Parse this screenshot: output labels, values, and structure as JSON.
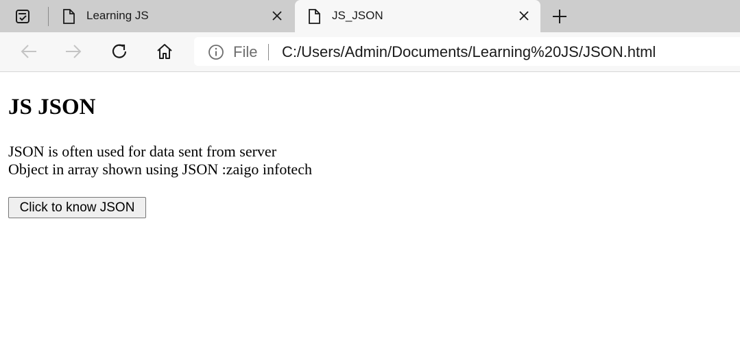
{
  "browser": {
    "tabs": [
      {
        "title": "Learning JS",
        "active": false
      },
      {
        "title": "JS_JSON",
        "active": true
      }
    ],
    "address_bar": {
      "scheme_label": "File",
      "url": "C:/Users/Admin/Documents/Learning%20JS/JSON.html"
    },
    "icons": {
      "tab_actions": "tab-actions-icon",
      "new_tab": "plus-icon",
      "back": "back-arrow-icon",
      "forward": "forward-arrow-icon",
      "reload": "reload-icon",
      "home": "home-icon",
      "site_info": "info-icon",
      "tab_favicon": "document-icon",
      "tab_close": "close-icon"
    },
    "colors": {
      "tabstrip": "#cdcdcd",
      "toolbar": "#f7f7f7",
      "page": "#ffffff"
    }
  },
  "page": {
    "heading": "JS JSON",
    "lines": [
      "JSON is often used for data sent from server",
      "Object in array shown using JSON :zaigo infotech"
    ],
    "button_label": "Click to know JSON"
  }
}
